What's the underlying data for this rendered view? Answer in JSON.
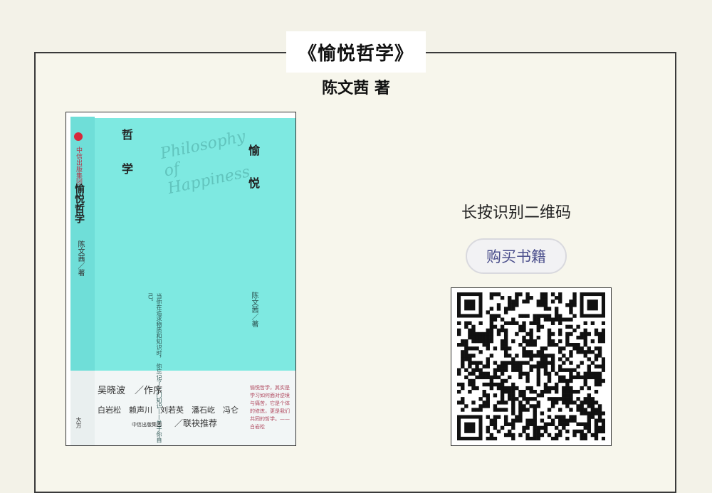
{
  "header": {
    "title": "《愉悦哲学》",
    "author": "陈文茜 著"
  },
  "book_cover": {
    "spine_publisher": "中信出版集团",
    "spine_title": "愉悦哲学",
    "spine_author": "陈文茜／著",
    "cover_title_left": [
      "哲",
      "学"
    ],
    "cover_title_right": [
      "愉",
      "悦"
    ],
    "script_text": "Philosophy of Happiness",
    "cover_quote": "当你在追求物质和知识时，\n你忘记了一门知识——关于你自己。",
    "cover_author": "陈文茜／著",
    "foreword": "吴晓波　／作序",
    "recommenders": "白岩松　赖声川　刘若英　潘石屹　冯仑",
    "recommend_label": "／联袂推荐",
    "blurb": "愉悦哲学，其实是学习如何面对逆境与痛苦，它是个体的修炼，更是我们共同的哲学。——白岩松",
    "bottom_publisher": "中信出版集团",
    "spine_bottom": "大方"
  },
  "qr_section": {
    "hint": "长按识别二维码",
    "buy_button": "购买书籍"
  }
}
